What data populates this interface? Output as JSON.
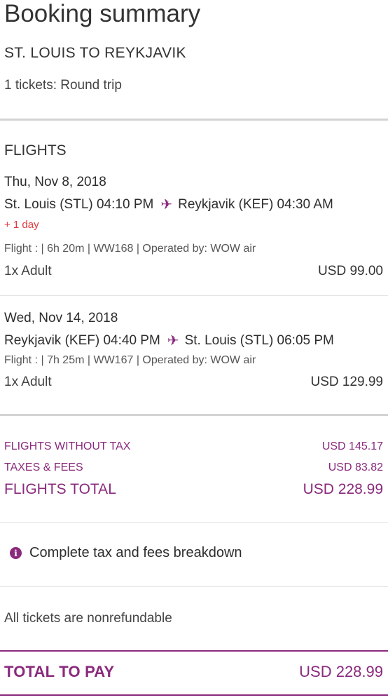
{
  "header": {
    "title": "Booking summary",
    "route": "ST. LOUIS TO REYKJAVIK",
    "tickets": "1 tickets: Round trip"
  },
  "flights": {
    "heading": "FLIGHTS",
    "legs": [
      {
        "date": "Thu, Nov 8, 2018",
        "origin": "St. Louis (STL) 04:10 PM",
        "destination": "Reykjavik (KEF) 04:30 AM",
        "day_offset": "+ 1 day",
        "details": "Flight : | 6h 20m | WW168 | Operated by: WOW air",
        "passenger": "1x Adult",
        "price": "USD 99.00"
      },
      {
        "date": "Wed, Nov 14, 2018",
        "origin": "Reykjavik (KEF) 04:40 PM",
        "destination": "St. Louis (STL) 06:05 PM",
        "details": "Flight : | 7h 25m | WW167 | Operated by: WOW air",
        "passenger": "1x Adult",
        "price": "USD 129.99"
      }
    ]
  },
  "summary": {
    "without_tax_label": "FLIGHTS WITHOUT TAX",
    "without_tax_value": "USD 145.17",
    "taxes_label": "TAXES & FEES",
    "taxes_value": "USD 83.82",
    "total_label": "FLIGHTS TOTAL",
    "total_value": "USD 228.99"
  },
  "breakdown_link": "Complete tax and fees breakdown",
  "nonrefundable": "All tickets are nonrefundable",
  "total_to_pay": {
    "label": "TOTAL TO PAY",
    "value": "USD 228.99"
  },
  "colors": {
    "accent": "#8a2a7c",
    "warning": "#e0393e"
  },
  "icons": {
    "plane": "airplane-icon",
    "info": "info-icon"
  }
}
